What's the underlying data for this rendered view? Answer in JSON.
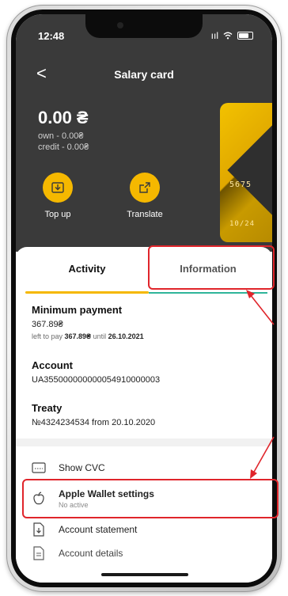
{
  "status_bar": {
    "time": "12:48",
    "signal": "ııl"
  },
  "header": {
    "back_glyph": "<",
    "title": "Salary card"
  },
  "balance": {
    "amount": "0.00 ₴",
    "own": "own - 0.00₴",
    "credit": "credit - 0.00₴"
  },
  "actions": [
    {
      "label": "Top up",
      "icon": "download-icon"
    },
    {
      "label": "Translate",
      "icon": "export-icon"
    }
  ],
  "card": {
    "number_fragment": "5675",
    "expiry": "10/24"
  },
  "tabs": [
    {
      "label": "Activity"
    },
    {
      "label": "Information"
    }
  ],
  "info": {
    "minimum_payment": {
      "title": "Minimum payment",
      "value": "367.89₴",
      "note_prefix": "left to pay ",
      "note_amount": "367.89₴",
      "note_mid": " until ",
      "note_date": "26.10.2021"
    },
    "account": {
      "title": "Account",
      "value": "UA355000000000054910000003"
    },
    "treaty": {
      "title": "Treaty",
      "value": "№4324234534 from 20.10.2020"
    }
  },
  "menu": [
    {
      "label": "Show CVC",
      "sub": "",
      "icon": "card-icon"
    },
    {
      "label": "Apple Wallet settings",
      "sub": "No active",
      "icon": "apple-icon"
    },
    {
      "label": "Account statement",
      "sub": "",
      "icon": "document-download-icon"
    },
    {
      "label": "Account details",
      "sub": "",
      "icon": "document-icon"
    }
  ],
  "colors": {
    "accent": "#f5b800",
    "header_bg": "#3a3a3a",
    "highlight": "#e0252b",
    "tab_underline": "#2fb59a"
  }
}
